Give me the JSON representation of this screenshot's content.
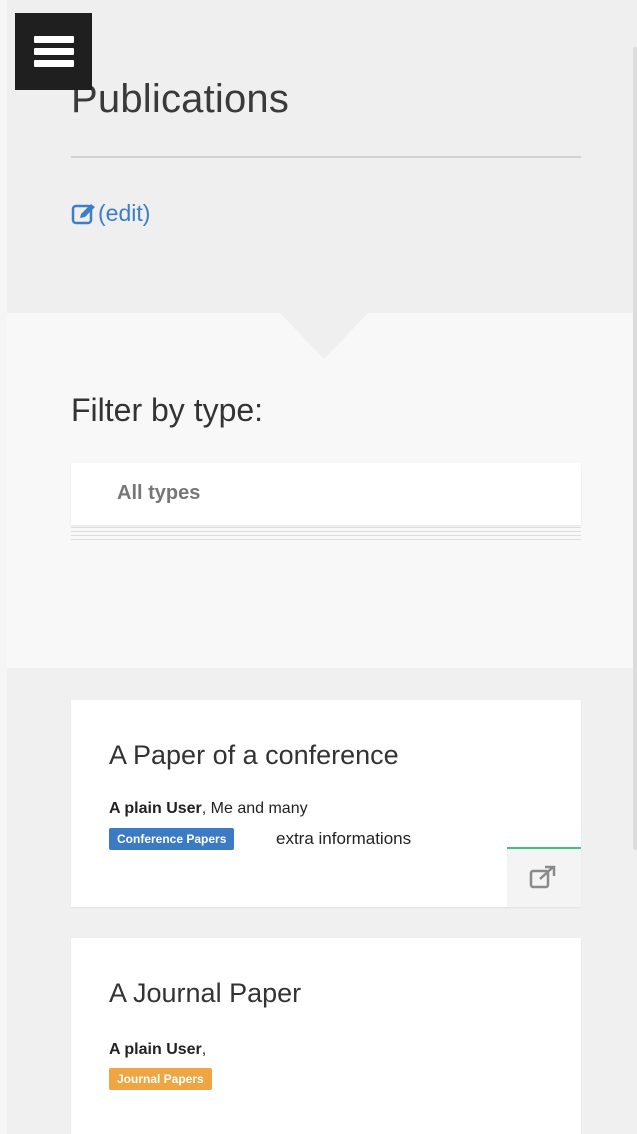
{
  "header": {
    "menu_icon": "hamburger-menu-icon",
    "title": "Publications",
    "edit_icon": "edit-pencil-icon",
    "edit_label": "(edit)"
  },
  "filter": {
    "label": "Filter by type:",
    "selected": "All types"
  },
  "publications": [
    {
      "title": "A Paper of a conference",
      "author_bold": "A plain User",
      "authors_rest": ", Me and many",
      "type": "Conference Papers",
      "extra": "extra informations",
      "external_icon": "external-link-icon",
      "colors": {
        "badge": "#3b7bc4",
        "accent": "#3dbf86"
      }
    },
    {
      "title": "A Journal Paper",
      "author_bold": "A plain User",
      "authors_rest": ",",
      "type": "Journal Papers",
      "colors": {
        "badge": "#efa642"
      }
    }
  ],
  "colors": {
    "link": "#3d7fc6",
    "menu_bg": "#1f1f1f"
  }
}
